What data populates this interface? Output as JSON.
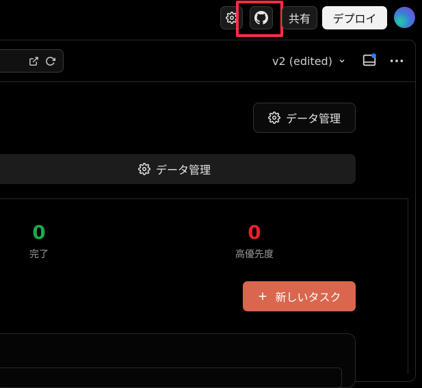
{
  "topbar": {
    "share_label": "共有",
    "deploy_label": "デプロイ",
    "settings_icon": "gear-icon",
    "github_icon": "github-icon",
    "highlight_color": "#ff2d45"
  },
  "toolbar": {
    "version_label": "v2 (edited)",
    "url_icons": [
      "external-link-icon",
      "reload-icon"
    ]
  },
  "main": {
    "data_manage_label": "データ管理",
    "data_manage_label_2": "データ管理",
    "stats": [
      {
        "value": "0",
        "label": "完了",
        "color": "#1fa84a"
      },
      {
        "value": "0",
        "label": "高優先度",
        "color": "#e5202a"
      }
    ],
    "new_task_label": "新しいタスク",
    "new_task_color": "#d9664d"
  }
}
